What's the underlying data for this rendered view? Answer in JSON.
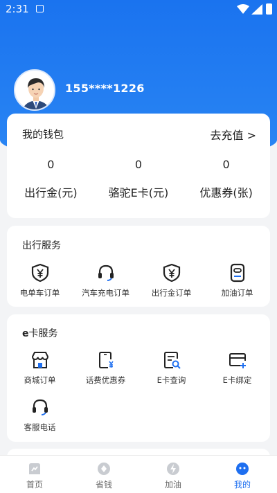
{
  "status_bar": {
    "time": "2:31"
  },
  "profile": {
    "phone": "155****1226"
  },
  "wallet": {
    "title": "我的钱包",
    "recharge": "去充值 >",
    "items": [
      {
        "value": "0",
        "label": "出行金(元)"
      },
      {
        "value": "0",
        "label": "骆驼E卡(元)"
      },
      {
        "value": "0",
        "label": "优惠券(张)"
      }
    ]
  },
  "travel": {
    "title": "出行服务",
    "items": [
      {
        "label": "电单车订单",
        "icon": "yen-shield-icon"
      },
      {
        "label": "汽车充电订单",
        "icon": "headset-icon"
      },
      {
        "label": "出行金订单",
        "icon": "yen-shield-icon"
      },
      {
        "label": "加油订单",
        "icon": "fuel-card-icon"
      }
    ]
  },
  "ecard": {
    "title_prefix": "e",
    "title_rest": "卡服务",
    "items": [
      {
        "label": "商城订单",
        "icon": "store-icon"
      },
      {
        "label": "话费优惠券",
        "icon": "phone-coupon-icon"
      },
      {
        "label": "E卡查询",
        "icon": "doc-search-icon"
      },
      {
        "label": "E卡绑定",
        "icon": "card-add-icon"
      },
      {
        "label": "客服电话",
        "icon": "headset-icon"
      }
    ]
  },
  "tabs": [
    {
      "label": "首页",
      "icon": "home-icon",
      "active": false
    },
    {
      "label": "省钱",
      "icon": "save-money-icon",
      "active": false
    },
    {
      "label": "加油",
      "icon": "lightning-icon",
      "active": false
    },
    {
      "label": "我的",
      "icon": "smile-icon",
      "active": true
    }
  ],
  "colors": {
    "primary": "#1e6ff0",
    "hero": "#1a73ef",
    "background": "#f3f4f6"
  }
}
